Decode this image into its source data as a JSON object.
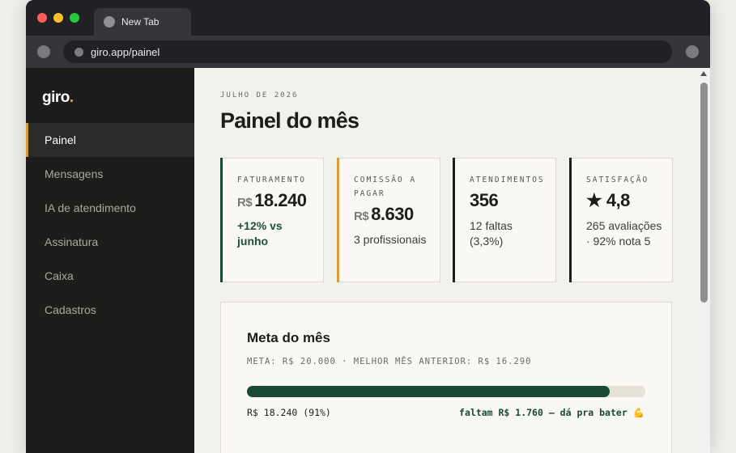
{
  "browser": {
    "tab_title": "New Tab",
    "url": "giro.app/painel"
  },
  "app": {
    "logo_text": "giro",
    "logo_dot": ".",
    "accent_color": "#d99a3a",
    "dark_green": "#184a33"
  },
  "sidebar": {
    "items": [
      {
        "label": "Painel",
        "active": true
      },
      {
        "label": "Mensagens",
        "active": false
      },
      {
        "label": "IA de atendimento",
        "active": false
      },
      {
        "label": "Assinatura",
        "active": false
      },
      {
        "label": "Caixa",
        "active": false
      },
      {
        "label": "Cadastros",
        "active": false
      }
    ]
  },
  "header": {
    "month": "JULHO DE 2026",
    "title": "Painel do mês"
  },
  "cards": [
    {
      "label": "FATURAMENTO",
      "currency": "R$",
      "value": "18.240",
      "sub": "+12% vs junho",
      "accent": "#184a33"
    },
    {
      "label": "COMISSÃO A PAGAR",
      "currency": "R$",
      "value": "8.630",
      "sub": "3 profissionais",
      "accent": "#d99a3a"
    },
    {
      "label": "ATENDIMENTOS",
      "value": "356",
      "sub": "12 faltas (3,3%)",
      "accent": "#1d1d1b"
    },
    {
      "label": "SATISFAÇÃO",
      "value": "★ 4,8",
      "sub": "265 avaliações · 92% nota 5",
      "accent": "#1d1d1b"
    }
  ],
  "goal": {
    "title": "Meta do mês",
    "meta": "META: R$ 20.000 · MELHOR MÊS ANTERIOR: R$ 16.290",
    "progress_percent": 91,
    "current": "R$ 18.240 (91%)",
    "remaining": "faltam R$ 1.760 — dá pra bater 💪"
  }
}
